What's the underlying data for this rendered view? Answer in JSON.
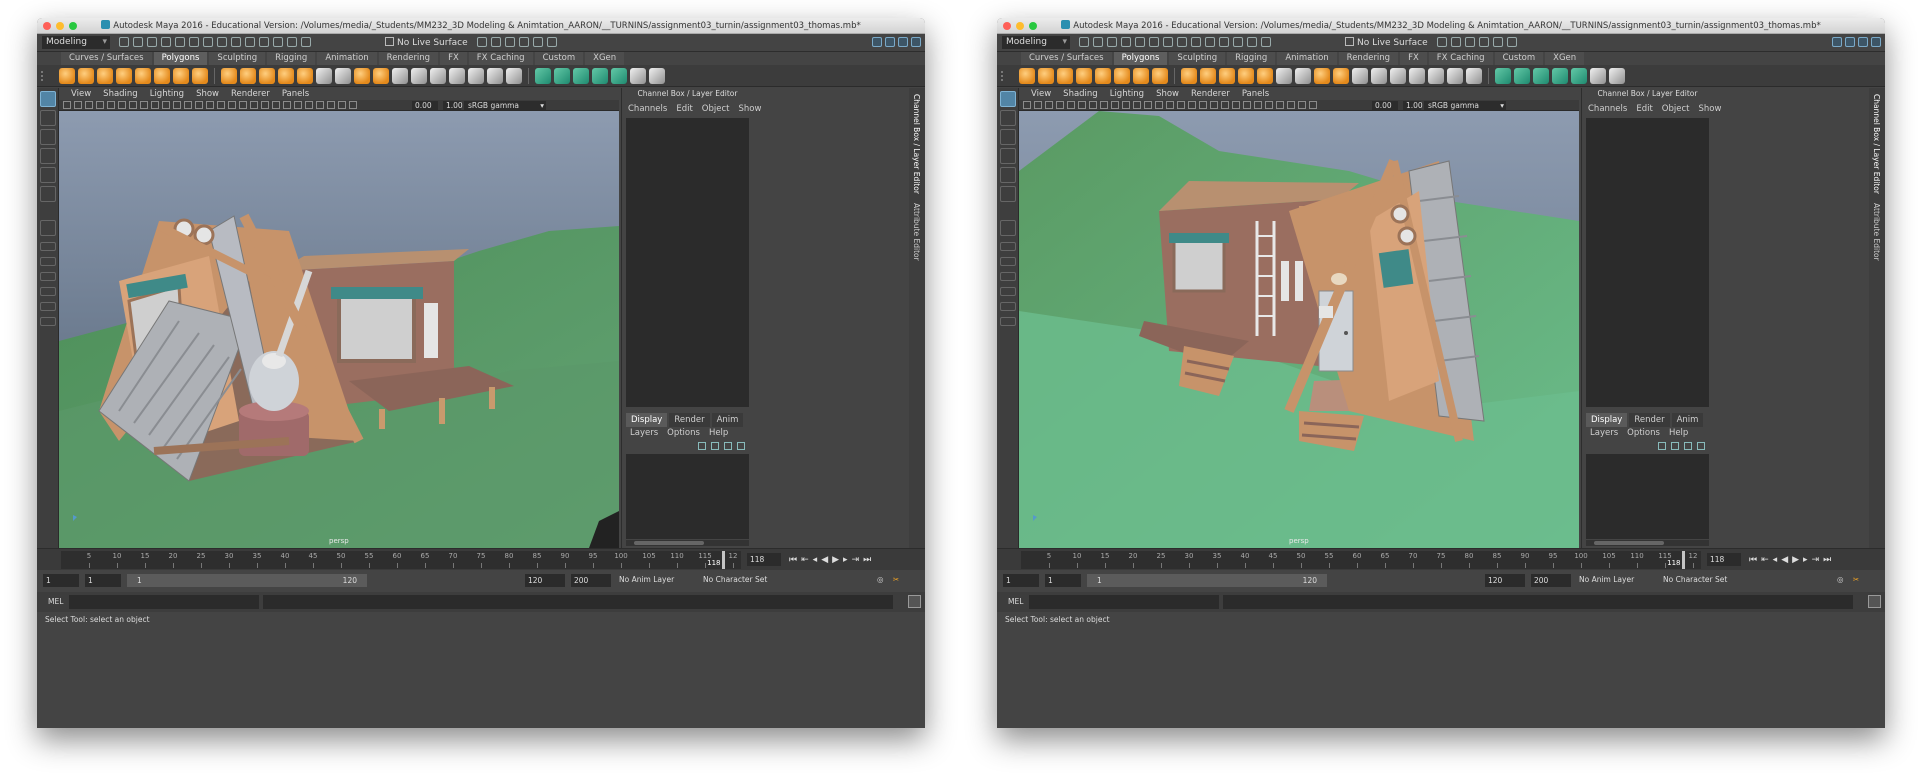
{
  "window_title": "Autodesk Maya 2016 - Educational Version: /Volumes/media/_Students/MM232_3D Modeling & Animtation_AARON/__TURNINS/assignment03_turnin/assignment03_thomas.mb*",
  "status_line": {
    "mode": "Modeling",
    "live_surface": "No Live Surface"
  },
  "shelf_tabs": [
    "Curves / Surfaces",
    "Polygons",
    "Sculpting",
    "Rigging",
    "Animation",
    "Rendering",
    "FX",
    "FX Caching",
    "Custom",
    "XGen"
  ],
  "viewport": {
    "menus": [
      "View",
      "Shading",
      "Lighting",
      "Show",
      "Renderer",
      "Panels"
    ],
    "exposure": "0.00",
    "gamma": "1.00",
    "color_space": "sRGB gamma",
    "camera": "persp"
  },
  "channel_box": {
    "title": "Channel Box / Layer Editor",
    "menus": [
      "Channels",
      "Edit",
      "Object",
      "Show"
    ],
    "layer_tabs": [
      "Display",
      "Render",
      "Anim"
    ],
    "layer_menus": [
      "Layers",
      "Options",
      "Help"
    ]
  },
  "side_tabs": [
    "Channel Box / Layer Editor",
    "Attribute Editor"
  ],
  "time_slider": {
    "ticks": [
      "5",
      "10",
      "15",
      "20",
      "25",
      "30",
      "35",
      "40",
      "45",
      "50",
      "55",
      "60",
      "65",
      "70",
      "75",
      "80",
      "85",
      "90",
      "95",
      "100",
      "105",
      "110",
      "115",
      "12"
    ],
    "current_frame": "118",
    "current_frame_input": "118"
  },
  "range_slider": {
    "start": "1",
    "playback_start": "1",
    "bar_start": "1",
    "bar_end": "120",
    "playback_end": "120",
    "end": "200",
    "anim_layer": "No Anim Layer",
    "character_set": "No Character Set"
  },
  "command_line": {
    "label": "MEL"
  },
  "help_line": "Select Tool: select an object"
}
